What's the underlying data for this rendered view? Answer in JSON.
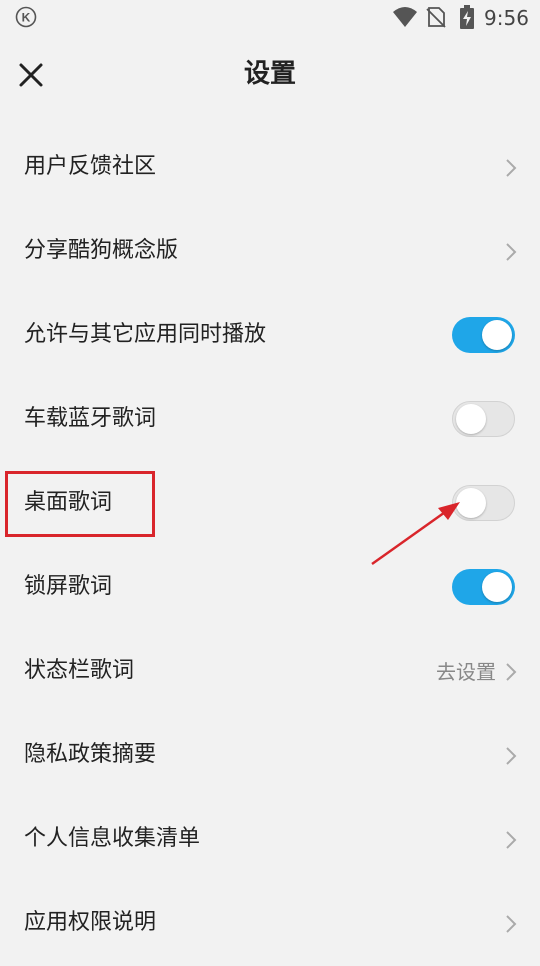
{
  "status_bar": {
    "time": "9:56",
    "icons": [
      "k-app-icon",
      "wifi-icon",
      "no-sim-icon",
      "battery-charging-icon"
    ],
    "k_letter": "K"
  },
  "header": {
    "title": "设置",
    "close_icon": "close-icon"
  },
  "settings": [
    {
      "label": "用户反馈社区",
      "type": "link"
    },
    {
      "label": "分享酷狗概念版",
      "type": "link"
    },
    {
      "label": "允许与其它应用同时播放",
      "type": "toggle",
      "on": true
    },
    {
      "label": "车载蓝牙歌词",
      "type": "toggle",
      "on": false
    },
    {
      "label": "桌面歌词",
      "type": "toggle",
      "on": false
    },
    {
      "label": "锁屏歌词",
      "type": "toggle",
      "on": true
    },
    {
      "label": "状态栏歌词",
      "type": "link",
      "value": "去设置"
    },
    {
      "label": "隐私政策摘要",
      "type": "link"
    },
    {
      "label": "个人信息收集清单",
      "type": "link"
    },
    {
      "label": "应用权限说明",
      "type": "link"
    }
  ],
  "colors": {
    "toggle_on": "#1fa6e8",
    "toggle_off": "#e6e6e6",
    "annotation": "#d9252b",
    "background": "#f2f2f2"
  }
}
